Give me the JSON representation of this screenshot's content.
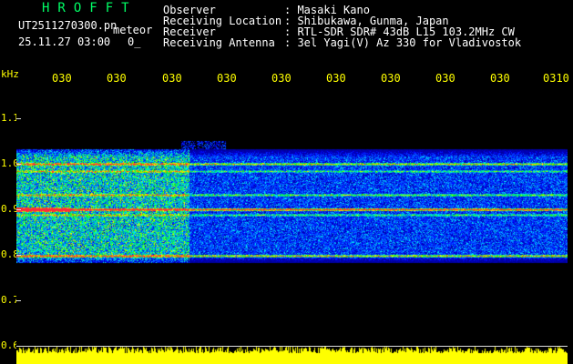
{
  "header": {
    "logo": "HROFFT",
    "filename": "UT2511270300.pn",
    "meteor_label": "meteor",
    "datetime": "25.11.27 03:00",
    "count": "0_",
    "fields": [
      {
        "label": "Observer",
        "value": ": Masaki Kano"
      },
      {
        "label": "Receiving Location",
        "value": ": Shibukawa, Gunma, Japan"
      },
      {
        "label": "Receiver",
        "value": ": RTL-SDR SDR# 43dB L15 103.2MHz CW"
      },
      {
        "label": "Receiving Antenna",
        "value": ": 3el Yagi(V) Az 330 for Vladivostok"
      }
    ]
  },
  "xaxis": {
    "ticks": [
      "030",
      "030",
      "030",
      "030",
      "030",
      "030",
      "030",
      "030",
      "030",
      "0310"
    ]
  },
  "yaxis": {
    "unit": "kHz",
    "ticks": [
      "1.1",
      "1.0",
      "0.9",
      "0.8",
      "0.7",
      "0.6"
    ]
  },
  "colors": {
    "background": "#000000",
    "labels": "#ffff00",
    "logo": "#00ff66",
    "noise_floor": "#ffff00"
  }
}
